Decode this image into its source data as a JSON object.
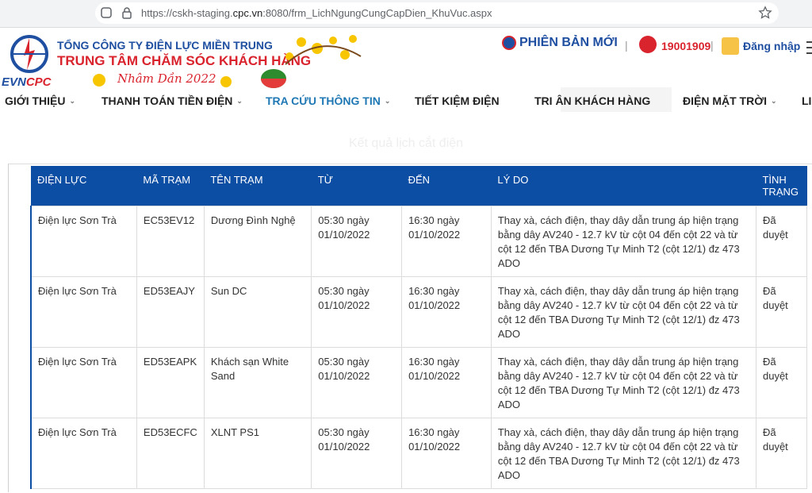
{
  "browser": {
    "url_prefix": "https://cskh-staging.",
    "url_domain": "cpc.vn",
    "url_suffix": ":8080/frm_LichNgungCungCapDien_KhuVuc.aspx"
  },
  "header": {
    "logo_text_a": "EVN",
    "logo_text_b": "CPC",
    "org_line1": "TỔNG CÔNG TY ĐIỆN LỰC MIỀN TRUNG",
    "org_line2": "TRUNG TÂM CHĂM SÓC KHÁCH HÀNG",
    "greeting": "Nhâm Dần 2022",
    "new_version": "PHIÊN BẢN MỚI",
    "hotline": "19001909",
    "login": "Đăng nhập"
  },
  "nav": {
    "items": [
      {
        "label": "GIỚI THIỆU"
      },
      {
        "label": "THANH TOÁN TIỀN ĐIỆN"
      },
      {
        "label": "TRA CỨU THÔNG TIN"
      },
      {
        "label": "TIẾT KIỆM ĐIỆN"
      },
      {
        "label": "TRI ÂN KHÁCH HÀNG"
      },
      {
        "label": "ĐIỆN MẶT TRỜI"
      },
      {
        "label": "LI"
      }
    ],
    "active_color": "#1f78b4"
  },
  "page_heading": "Kết quả lịch cắt điện",
  "table": {
    "header_color": "#0d4ea5",
    "columns": [
      "ĐIỆN LỰC",
      "MÃ TRẠM",
      "TÊN TRẠM",
      "TỪ",
      "ĐẾN",
      "LÝ DO",
      "TÌNH TRẠNG"
    ],
    "rows": [
      {
        "dien_luc": "Điện lực Sơn Trà",
        "ma_tram": "EC53EV12",
        "ten_tram": "Dương Đình Nghệ",
        "tu": "05:30 ngày 01/10/2022",
        "den": "16:30 ngày 01/10/2022",
        "ly_do": "Thay xà, cách điện, thay dây dẫn trung áp hiện trạng bằng dây AV240 - 12.7 kV từ cột 04 đến cột 22 và từ cột 12 đến TBA Dương Tự Minh T2 (cột 12/1) đz 473 ADO",
        "tinh_trang": "Đã duyệt"
      },
      {
        "dien_luc": "Điện lực Sơn Trà",
        "ma_tram": "ED53EAJY",
        "ten_tram": "Sun DC",
        "tu": "05:30 ngày 01/10/2022",
        "den": "16:30 ngày 01/10/2022",
        "ly_do": "Thay xà, cách điện, thay dây dẫn trung áp hiện trạng bằng dây AV240 - 12.7 kV từ cột 04 đến cột 22 và từ cột 12 đến TBA Dương Tự Minh T2 (cột 12/1) đz 473 ADO",
        "tinh_trang": "Đã duyệt"
      },
      {
        "dien_luc": "Điện lực Sơn Trà",
        "ma_tram": "ED53EAPK",
        "ten_tram": "Khách sạn White Sand",
        "tu": "05:30 ngày 01/10/2022",
        "den": "16:30 ngày 01/10/2022",
        "ly_do": "Thay xà, cách điện, thay dây dẫn trung áp hiện trạng bằng dây AV240 - 12.7 kV từ cột 04 đến cột 22 và từ cột 12 đến TBA Dương Tự Minh T2 (cột 12/1) đz 473 ADO",
        "tinh_trang": "Đã duyệt"
      },
      {
        "dien_luc": "Điện lực Sơn Trà",
        "ma_tram": "ED53ECFC",
        "ten_tram": "XLNT PS1",
        "tu": "05:30 ngày 01/10/2022",
        "den": "16:30 ngày 01/10/2022",
        "ly_do": "Thay xà, cách điện, thay dây dẫn trung áp hiện trạng bằng dây AV240 - 12.7 kV từ cột 04 đến cột 22 và từ cột 12 đến TBA Dương Tự Minh T2 (cột 12/1) đz 473 ADO",
        "tinh_trang": "Đã duyệt"
      }
    ]
  }
}
